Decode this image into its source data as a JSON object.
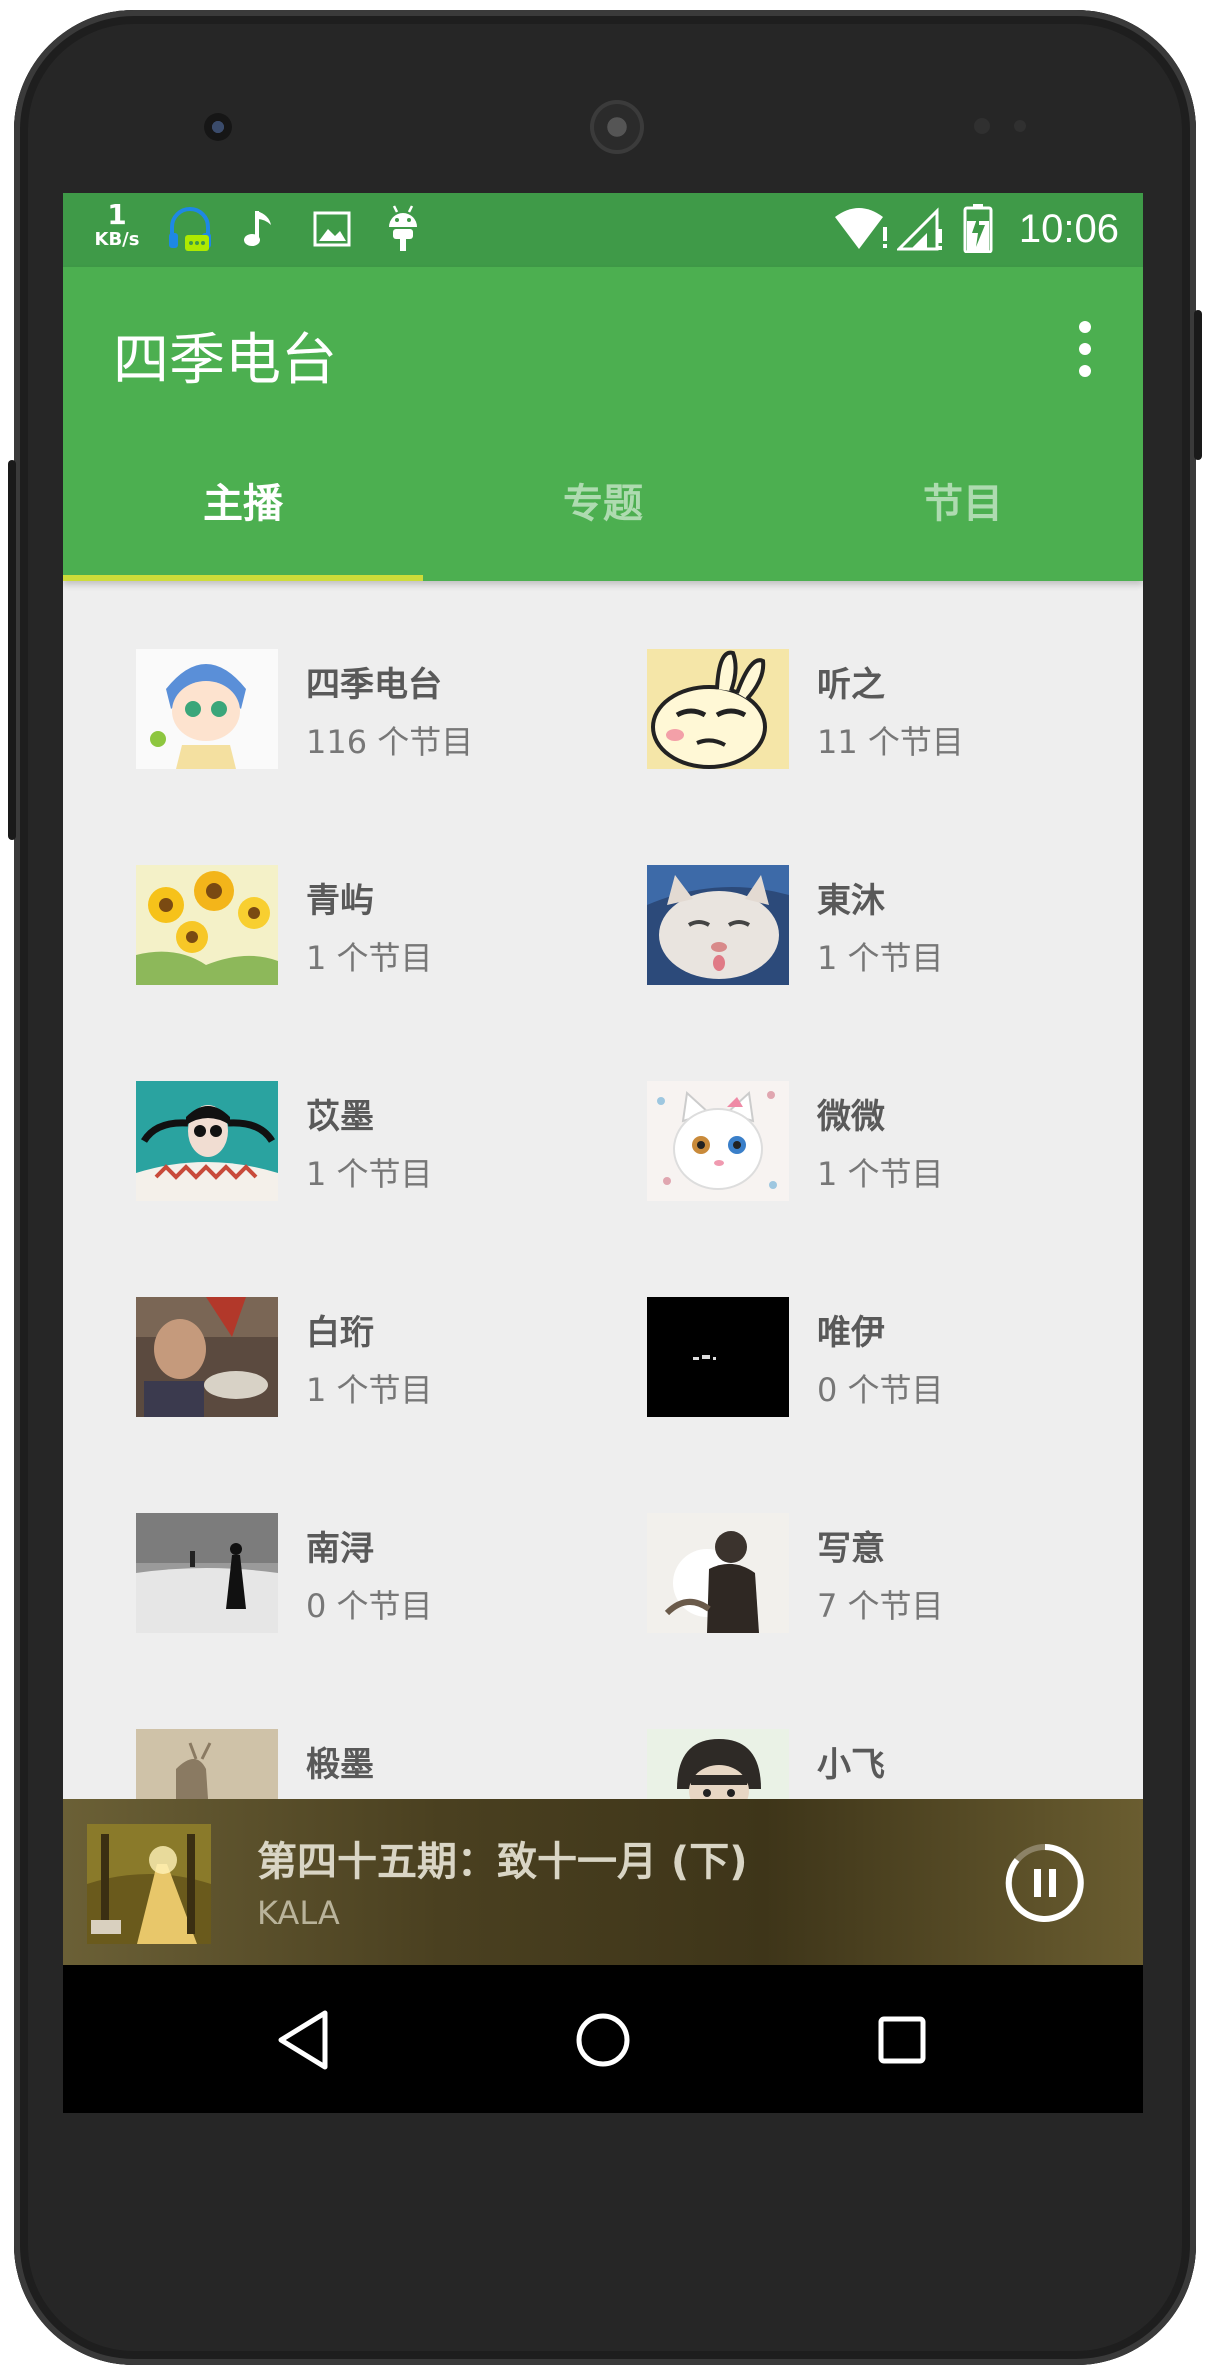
{
  "status_bar": {
    "net_speed_value": "1",
    "net_speed_unit": "KB/s",
    "time": "10:06",
    "icons": [
      "headset-icon",
      "music-note-icon",
      "image-icon",
      "android-icon",
      "wifi-icon",
      "signal-icon",
      "battery-icon"
    ]
  },
  "app_bar": {
    "title": "四季电台",
    "menu_icon": "overflow-menu-icon"
  },
  "tabs": [
    {
      "label": "主播",
      "active": true
    },
    {
      "label": "专题",
      "active": false
    },
    {
      "label": "节目",
      "active": false
    }
  ],
  "hosts": [
    {
      "name": "四季电台",
      "count": "116 个节目"
    },
    {
      "name": "听之",
      "count": "11 个节目"
    },
    {
      "name": "青屿",
      "count": "1 个节目"
    },
    {
      "name": "東沐",
      "count": "1 个节目"
    },
    {
      "name": "苡墨",
      "count": "1 个节目"
    },
    {
      "name": "微微",
      "count": "1 个节目"
    },
    {
      "name": "白珩",
      "count": "1 个节目"
    },
    {
      "name": "唯伊",
      "count": "0 个节目"
    },
    {
      "name": "南浔",
      "count": "0 个节目"
    },
    {
      "name": "写意",
      "count": "7 个节目"
    },
    {
      "name": "椴墨",
      "count": ""
    },
    {
      "name": "小飞",
      "count": ""
    }
  ],
  "player": {
    "title": "第四十五期：致十一月 (下)",
    "artist": "KALA",
    "state_icon": "pause-icon"
  },
  "nav_bar": {
    "icons": [
      "back-icon",
      "home-icon",
      "recents-icon"
    ]
  },
  "colors": {
    "primary": "#4caf50",
    "primary_dark": "#3f9a48",
    "accent": "#cddc39",
    "background": "#eeeeee"
  }
}
